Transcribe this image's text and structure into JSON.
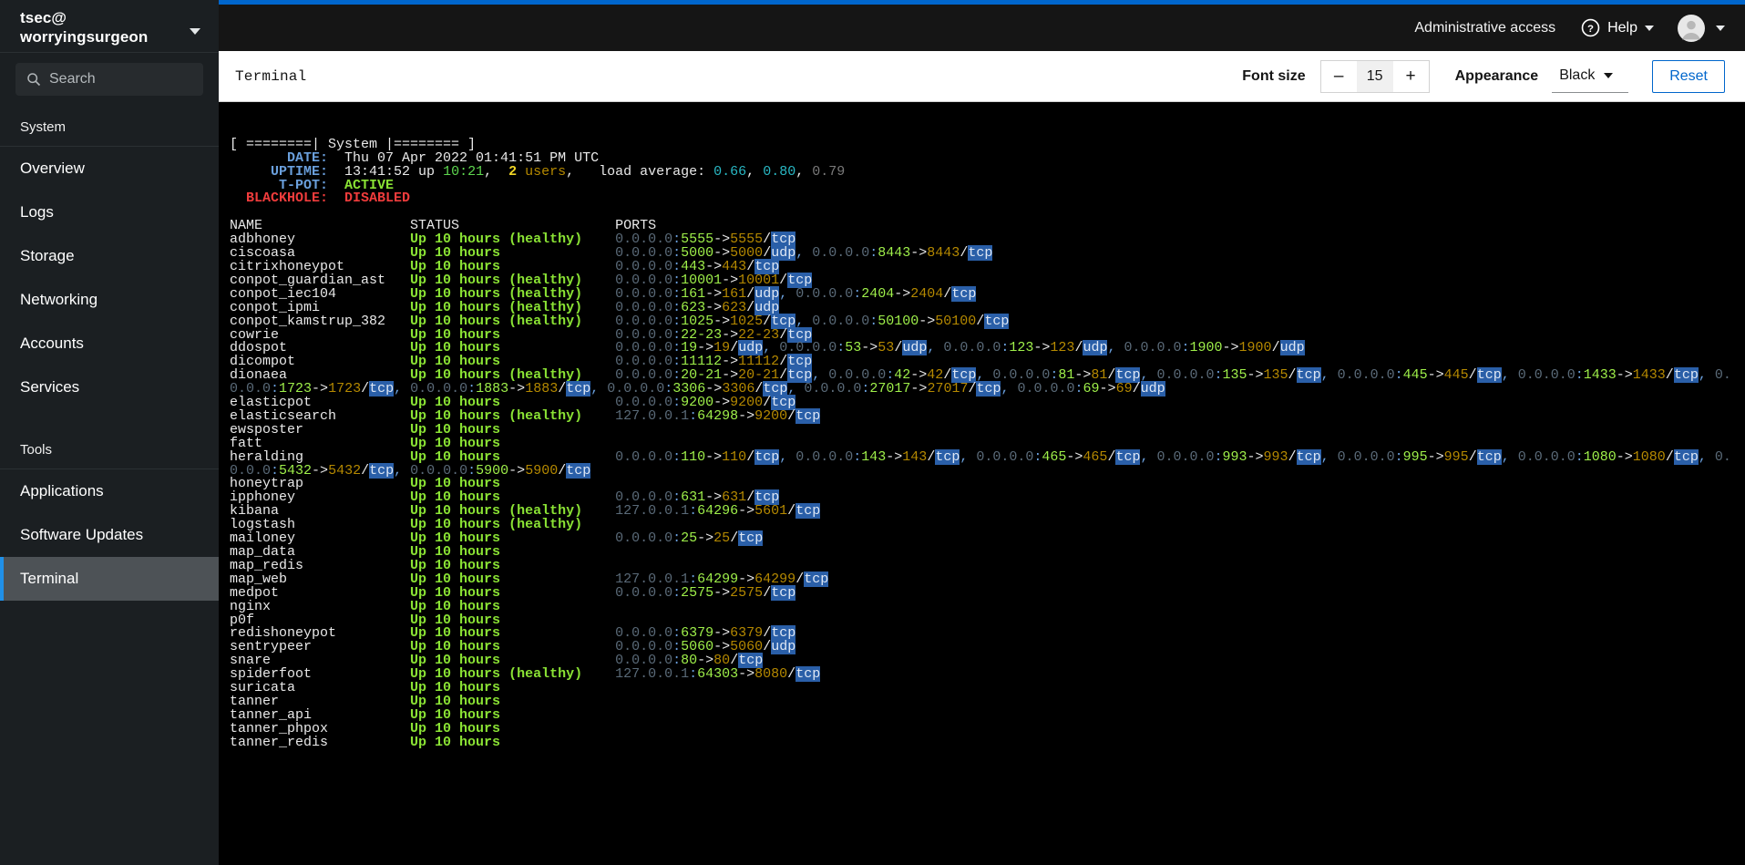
{
  "sidebar": {
    "host_line1": "tsec@",
    "host_line2": "worryingsurgeon",
    "search_placeholder": "Search",
    "group_system": "System",
    "group_tools": "Tools",
    "system_items": [
      {
        "label": "Overview"
      },
      {
        "label": "Logs"
      },
      {
        "label": "Storage"
      },
      {
        "label": "Networking"
      },
      {
        "label": "Accounts"
      },
      {
        "label": "Services"
      }
    ],
    "tools_items": [
      {
        "label": "Applications"
      },
      {
        "label": "Software Updates"
      },
      {
        "label": "Terminal"
      }
    ],
    "active_item": "Terminal"
  },
  "masthead": {
    "admin_access": "Administrative access",
    "help_label": "Help"
  },
  "toolbar": {
    "title": "Terminal",
    "font_size_label": "Font size",
    "font_size_value": "15",
    "minus_label": "–",
    "plus_label": "+",
    "appearance_label": "Appearance",
    "appearance_value": "Black",
    "reset_label": "Reset"
  },
  "terminal": {
    "banner": "[ ========| System |======== ]",
    "fields": {
      "date_label": "       DATE:",
      "date_value": "Thu 07 Apr 2022 01:41:51 PM UTC",
      "uptime_label": "     UPTIME:",
      "uptime_time": " 13:41:52 up ",
      "uptime_up": "10:21",
      "uptime_users_count": "2",
      "uptime_users_word": " users",
      "load_label": "  load average: ",
      "load1": "0.66",
      "load2": "0.80",
      "load3": "0.79",
      "tpot_label": "      T-POT:",
      "tpot_value": "ACTIVE",
      "blackhole_label": "  BLACKHOLE:",
      "blackhole_value": "DISABLED"
    },
    "columns": {
      "name": "NAME",
      "status": "STATUS",
      "ports": "PORTS"
    },
    "rows": [
      {
        "name": "adbhoney",
        "status": "Up 10 hours (healthy)",
        "ports": "0.0.0.0:5555->5555/tcp"
      },
      {
        "name": "ciscoasa",
        "status": "Up 10 hours",
        "ports": "0.0.0.0:5000->5000/udp, 0.0.0.0:8443->8443/tcp"
      },
      {
        "name": "citrixhoneypot",
        "status": "Up 10 hours",
        "ports": "0.0.0.0:443->443/tcp"
      },
      {
        "name": "conpot_guardian_ast",
        "status": "Up 10 hours (healthy)",
        "ports": "0.0.0.0:10001->10001/tcp"
      },
      {
        "name": "conpot_iec104",
        "status": "Up 10 hours (healthy)",
        "ports": "0.0.0.0:161->161/udp, 0.0.0.0:2404->2404/tcp"
      },
      {
        "name": "conpot_ipmi",
        "status": "Up 10 hours (healthy)",
        "ports": "0.0.0.0:623->623/udp"
      },
      {
        "name": "conpot_kamstrup_382",
        "status": "Up 10 hours (healthy)",
        "ports": "0.0.0.0:1025->1025/tcp, 0.0.0.0:50100->50100/tcp"
      },
      {
        "name": "cowrie",
        "status": "Up 10 hours",
        "ports": "0.0.0.0:22-23->22-23/tcp"
      },
      {
        "name": "ddospot",
        "status": "Up 10 hours",
        "ports": "0.0.0.0:19->19/udp, 0.0.0.0:53->53/udp, 0.0.0.0:123->123/udp, 0.0.0.0:1900->1900/udp"
      },
      {
        "name": "dicompot",
        "status": "Up 10 hours",
        "ports": "0.0.0.0:11112->11112/tcp"
      },
      {
        "name": "dionaea",
        "status": "Up 10 hours (healthy)",
        "ports": "0.0.0.0:20-21->20-21/tcp, 0.0.0.0:42->42/tcp, 0.0.0.0:81->81/tcp, 0.0.0.0:135->135/tcp, 0.0.0.0:445->445/tcp, 0.0.0.0:1433->1433/tcp, 0.0.0.0:1723->1723/tcp, 0.0.0.0:1883->1883/tcp, 0.0.0.0:3306->3306/tcp, 0.0.0.0:27017->27017/tcp, 0.0.0.0:69->69/udp"
      },
      {
        "name": "elasticpot",
        "status": "Up 10 hours",
        "ports": "0.0.0.0:9200->9200/tcp"
      },
      {
        "name": "elasticsearch",
        "status": "Up 10 hours (healthy)",
        "ports": "127.0.0.1:64298->9200/tcp"
      },
      {
        "name": "ewsposter",
        "status": "Up 10 hours",
        "ports": ""
      },
      {
        "name": "fatt",
        "status": "Up 10 hours",
        "ports": ""
      },
      {
        "name": "heralding",
        "status": "Up 10 hours",
        "ports": "0.0.0.0:110->110/tcp, 0.0.0.0:143->143/tcp, 0.0.0.0:465->465/tcp, 0.0.0.0:993->993/tcp, 0.0.0.0:995->995/tcp, 0.0.0.0:1080->1080/tcp, 0.0.0.0:5432->5432/tcp, 0.0.0.0:5900->5900/tcp"
      },
      {
        "name": "honeytrap",
        "status": "Up 10 hours",
        "ports": ""
      },
      {
        "name": "ipphoney",
        "status": "Up 10 hours",
        "ports": "0.0.0.0:631->631/tcp"
      },
      {
        "name": "kibana",
        "status": "Up 10 hours (healthy)",
        "ports": "127.0.0.1:64296->5601/tcp"
      },
      {
        "name": "logstash",
        "status": "Up 10 hours (healthy)",
        "ports": ""
      },
      {
        "name": "mailoney",
        "status": "Up 10 hours",
        "ports": "0.0.0.0:25->25/tcp"
      },
      {
        "name": "map_data",
        "status": "Up 10 hours",
        "ports": ""
      },
      {
        "name": "map_redis",
        "status": "Up 10 hours",
        "ports": ""
      },
      {
        "name": "map_web",
        "status": "Up 10 hours",
        "ports": "127.0.0.1:64299->64299/tcp"
      },
      {
        "name": "medpot",
        "status": "Up 10 hours",
        "ports": "0.0.0.0:2575->2575/tcp"
      },
      {
        "name": "nginx",
        "status": "Up 10 hours",
        "ports": ""
      },
      {
        "name": "p0f",
        "status": "Up 10 hours",
        "ports": ""
      },
      {
        "name": "redishoneypot",
        "status": "Up 10 hours",
        "ports": "0.0.0.0:6379->6379/tcp"
      },
      {
        "name": "sentrypeer",
        "status": "Up 10 hours",
        "ports": "0.0.0.0:5060->5060/udp"
      },
      {
        "name": "snare",
        "status": "Up 10 hours",
        "ports": "0.0.0.0:80->80/tcp"
      },
      {
        "name": "spiderfoot",
        "status": "Up 10 hours (healthy)",
        "ports": "127.0.0.1:64303->8080/tcp"
      },
      {
        "name": "suricata",
        "status": "Up 10 hours",
        "ports": ""
      },
      {
        "name": "tanner",
        "status": "Up 10 hours",
        "ports": ""
      },
      {
        "name": "tanner_api",
        "status": "Up 10 hours",
        "ports": ""
      },
      {
        "name": "tanner_phpox",
        "status": "Up 10 hours",
        "ports": ""
      },
      {
        "name": "tanner_redis",
        "status": "Up 10 hours",
        "ports": ""
      }
    ]
  },
  "colors": {
    "accent": "#0066cc",
    "sidebar_bg": "#1b1f22",
    "terminal_bg": "#000000",
    "status_green": "#5ed64f",
    "active_green": "#8ae234",
    "disabled_red": "#f03c3c",
    "highlight_blue": "#2a5fa8"
  }
}
